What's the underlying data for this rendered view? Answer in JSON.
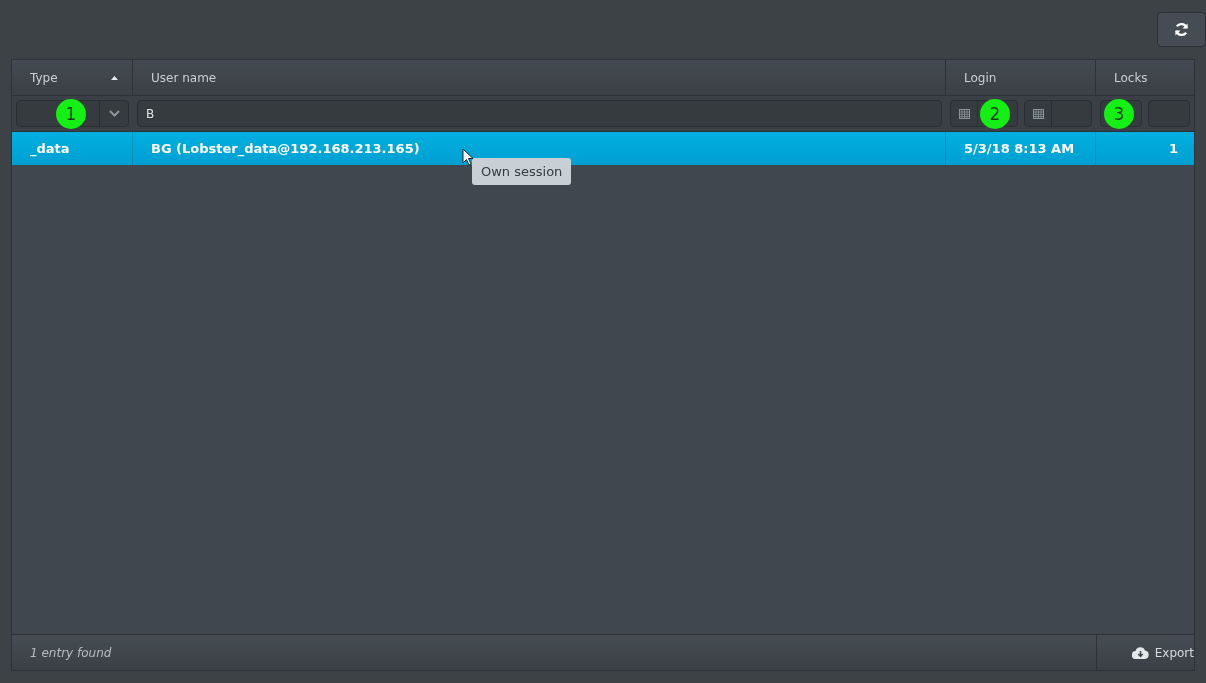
{
  "columns": [
    {
      "label": "Type",
      "sorted": true
    },
    {
      "label": "User name",
      "sorted": false
    },
    {
      "label": "Login",
      "sorted": false
    },
    {
      "label": "Locks",
      "sorted": false
    }
  ],
  "filters": [
    {
      "kind": "select",
      "marker": "1"
    },
    {
      "kind": "text",
      "value": "B"
    },
    {
      "kind": "date_range",
      "marker": "2"
    },
    {
      "kind": "number_range",
      "marker": "3"
    }
  ],
  "rows": [
    {
      "selected": true,
      "cells": [
        "_data",
        "BG (Lobster_data@192.168.213.165)",
        "5/3/18 8:13 AM",
        "1"
      ]
    }
  ],
  "tooltip": "Own session",
  "footer": {
    "status": "1 entry found",
    "export": "Export"
  }
}
